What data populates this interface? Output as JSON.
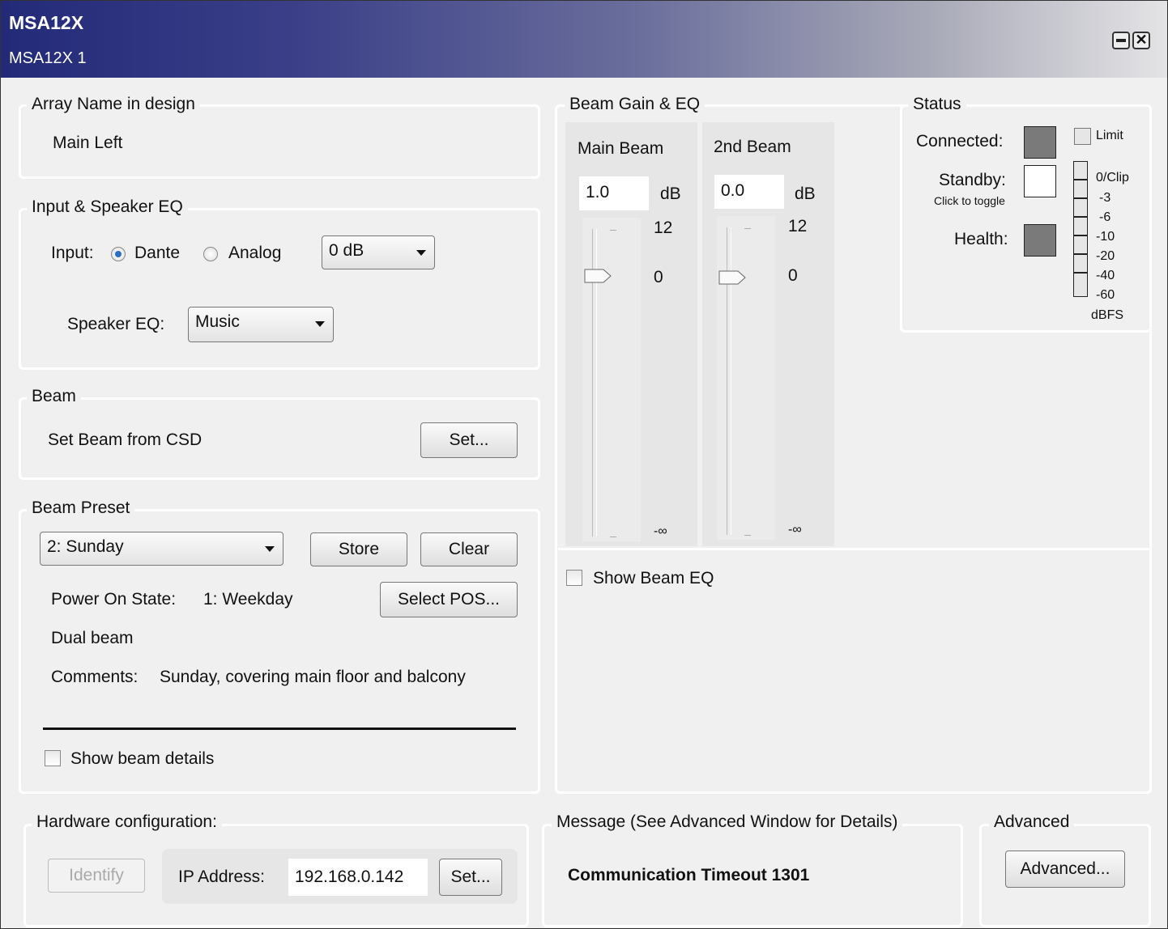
{
  "window": {
    "title": "MSA12X",
    "subtitle": "MSA12X 1"
  },
  "array": {
    "label": "Array Name in design",
    "name": "Main Left"
  },
  "input_eq": {
    "label": "Input & Speaker EQ",
    "input_label": "Input:",
    "options": [
      "Dante",
      "Analog"
    ],
    "selected_input": "Dante",
    "gain_value": "0 dB",
    "speaker_eq_label": "Speaker EQ:",
    "speaker_eq_value": "Music"
  },
  "beam": {
    "label": "Beam",
    "text": "Set Beam from CSD",
    "set_button": "Set..."
  },
  "preset": {
    "label": "Beam Preset",
    "selected": "2: Sunday",
    "store_button": "Store",
    "clear_button": "Clear",
    "pos_label": "Power On State:",
    "pos_value": "1: Weekday",
    "select_pos_button": "Select POS...",
    "mode": "Dual beam",
    "comments_label": "Comments:",
    "comments_value": "Sunday, covering main floor and balcony",
    "details_checkbox": "Show beam details"
  },
  "gain": {
    "label": "Beam Gain & EQ",
    "main": {
      "title": "Main Beam",
      "value": "1.0",
      "unit": "dB",
      "max": "12",
      "mid": "0",
      "min": "-∞"
    },
    "second": {
      "title": "2nd Beam",
      "value": "0.0",
      "unit": "dB",
      "max": "12",
      "mid": "0",
      "min": "-∞"
    },
    "eq_checkbox": "Show Beam EQ"
  },
  "status": {
    "label": "Status",
    "connected": "Connected:",
    "standby": "Standby:",
    "toggle_hint": "Click to toggle",
    "health": "Health:",
    "limit": "Limit",
    "meter_labels": [
      "0/Clip",
      "-3",
      "-6",
      "-10",
      "-20",
      "-40",
      "-60"
    ],
    "meter_unit": "dBFS",
    "colors": {
      "connected": "#7a7a7a",
      "standby": "#ffffff",
      "health": "#7a7a7a"
    }
  },
  "hardware": {
    "label": "Hardware configuration:",
    "identify_button": "Identify",
    "ip_label": "IP Address:",
    "ip_value": "192.168.0.142",
    "set_button": "Set..."
  },
  "message": {
    "label": "Message (See Advanced Window for Details)",
    "text": "Communication Timeout 1301"
  },
  "advanced": {
    "label": "Advanced",
    "button": "Advanced..."
  }
}
